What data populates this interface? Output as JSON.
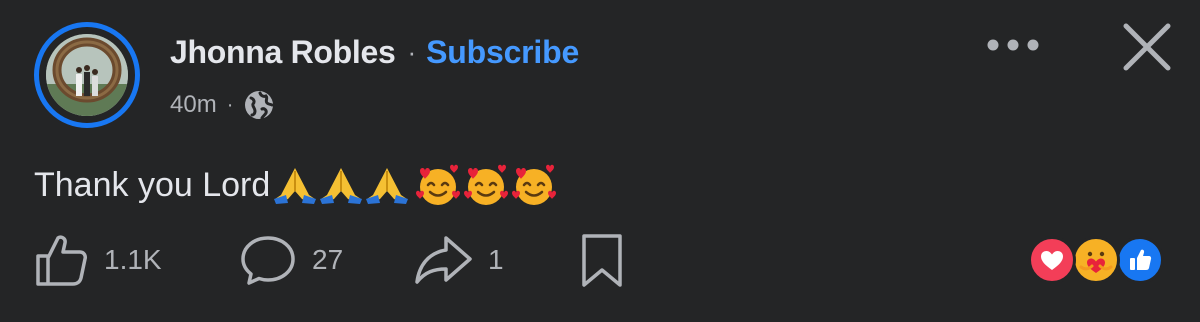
{
  "post": {
    "author_name": "Jhonna Robles",
    "separator": "·",
    "subscribe_label": "Subscribe",
    "time": "40m",
    "meta_separator": "·",
    "privacy_icon": "globe-icon",
    "text": "Thank you Lord",
    "emojis": [
      "folded-hands",
      "folded-hands",
      "folded-hands",
      "smiling-face-with-hearts",
      "smiling-face-with-hearts",
      "smiling-face-with-hearts"
    ]
  },
  "actions": {
    "like_count": "1.1K",
    "comment_count": "27",
    "share_count": "1"
  },
  "reactions": [
    "love",
    "care",
    "like"
  ],
  "colors": {
    "background": "#242526",
    "accent": "#4599ff",
    "ring": "#1877f2",
    "text": "#e4e6eb",
    "secondary_text": "#b0b3b8",
    "love": "#f33e58",
    "like": "#1877f2",
    "care": "#f7b125"
  }
}
